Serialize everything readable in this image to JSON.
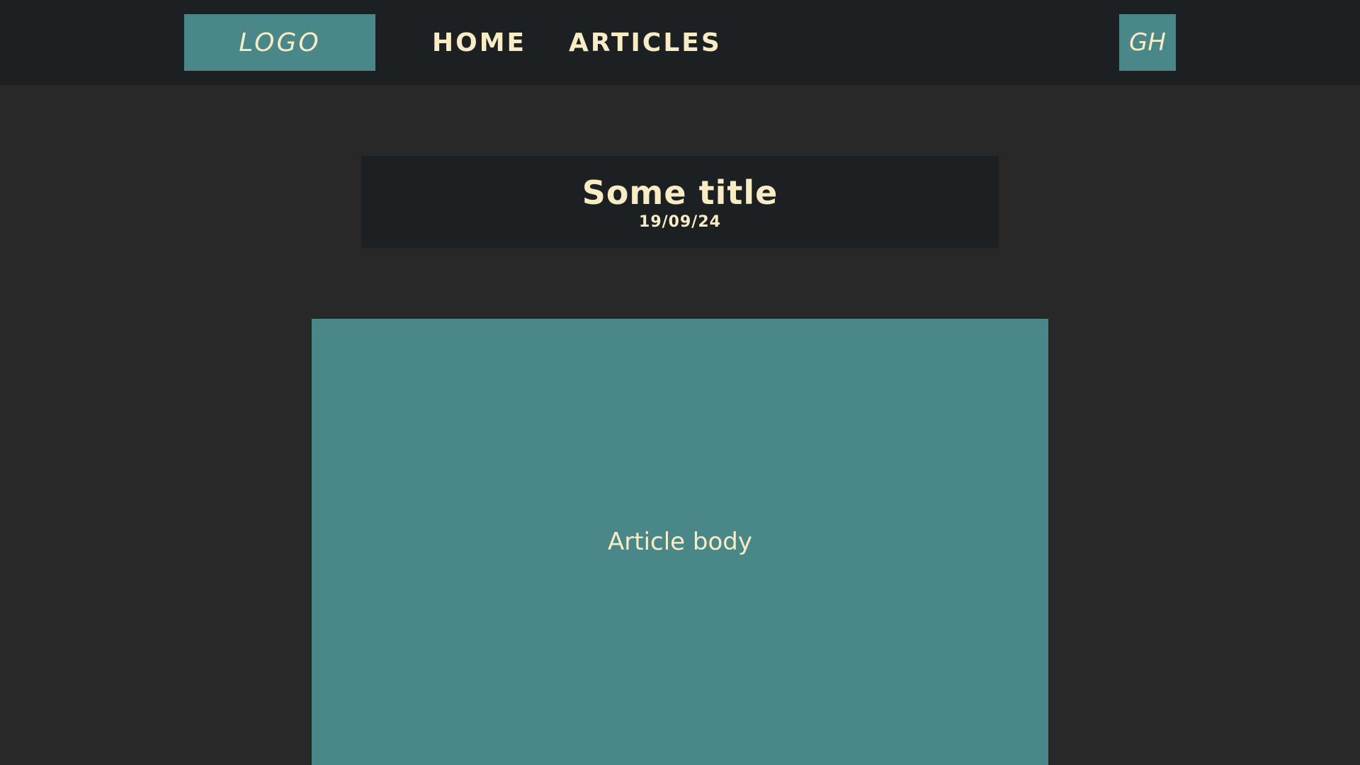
{
  "navbar": {
    "logo": "LOGO",
    "links": [
      {
        "label": "HOME"
      },
      {
        "label": "ARTICLES"
      }
    ],
    "github": "GH"
  },
  "article": {
    "title": "Some title",
    "date": "19/09/24",
    "body": "Article body"
  },
  "colors": {
    "background": "#282828",
    "navbar": "#1c2022",
    "accent": "#498789",
    "text": "#f7ecc4"
  }
}
